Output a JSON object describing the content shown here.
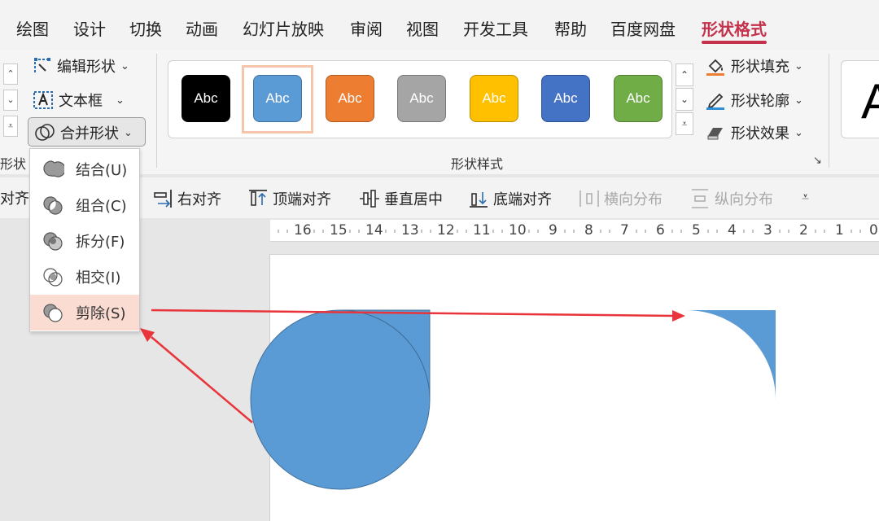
{
  "tabs": [
    {
      "label": "绘图"
    },
    {
      "label": "设计"
    },
    {
      "label": "切换"
    },
    {
      "label": "动画"
    },
    {
      "label": "幻灯片放映"
    },
    {
      "label": "审阅"
    },
    {
      "label": "视图"
    },
    {
      "label": "开发工具"
    },
    {
      "label": "帮助"
    },
    {
      "label": "百度网盘"
    },
    {
      "label": "形状格式",
      "active": true
    }
  ],
  "ribbon": {
    "insert_shapes": {
      "edit_shape": "编辑形状",
      "text_box": "文本框",
      "merge_shapes": "合并形状",
      "group_label_partial": "形状"
    },
    "shape_styles": {
      "group_label": "形状样式",
      "swatches": [
        {
          "text": "Abc",
          "color": "#000000"
        },
        {
          "text": "Abc",
          "color": "#5b9bd5",
          "selected": true
        },
        {
          "text": "Abc",
          "color": "#ed7d31"
        },
        {
          "text": "Abc",
          "color": "#a5a5a5"
        },
        {
          "text": "Abc",
          "color": "#ffc000"
        },
        {
          "text": "Abc",
          "color": "#4472c4"
        },
        {
          "text": "Abc",
          "color": "#70ad47"
        }
      ],
      "shape_fill": "形状填充",
      "shape_outline": "形状轮廓",
      "shape_effects": "形状效果"
    },
    "wordart_preview": "A"
  },
  "merge_menu": {
    "items": [
      {
        "label": "结合(U)",
        "icon": "union-icon"
      },
      {
        "label": "组合(C)",
        "icon": "combine-icon"
      },
      {
        "label": "拆分(F)",
        "icon": "fragment-icon"
      },
      {
        "label": "相交(I)",
        "icon": "intersect-icon"
      },
      {
        "label": "剪除(S)",
        "icon": "subtract-icon",
        "highlighted": true
      }
    ]
  },
  "align_bar": {
    "partial_left": "对齐",
    "right_align": "右对齐",
    "top_align": "顶端对齐",
    "middle_align": "垂直居中",
    "bottom_align": "底端对齐",
    "distribute_horizontal": "横向分布",
    "distribute_vertical": "纵向分布"
  },
  "ruler": {
    "numbers": [
      "16",
      "15",
      "14",
      "13",
      "12",
      "11",
      "10",
      "9",
      "8",
      "7",
      "6",
      "5",
      "4",
      "3",
      "2",
      "1",
      "0"
    ]
  },
  "colors": {
    "accent": "#c4314b",
    "shape_fill": "#5b9bd5",
    "annotation_arrow": "#e8343a",
    "menu_highlight": "#fbdcd3"
  }
}
